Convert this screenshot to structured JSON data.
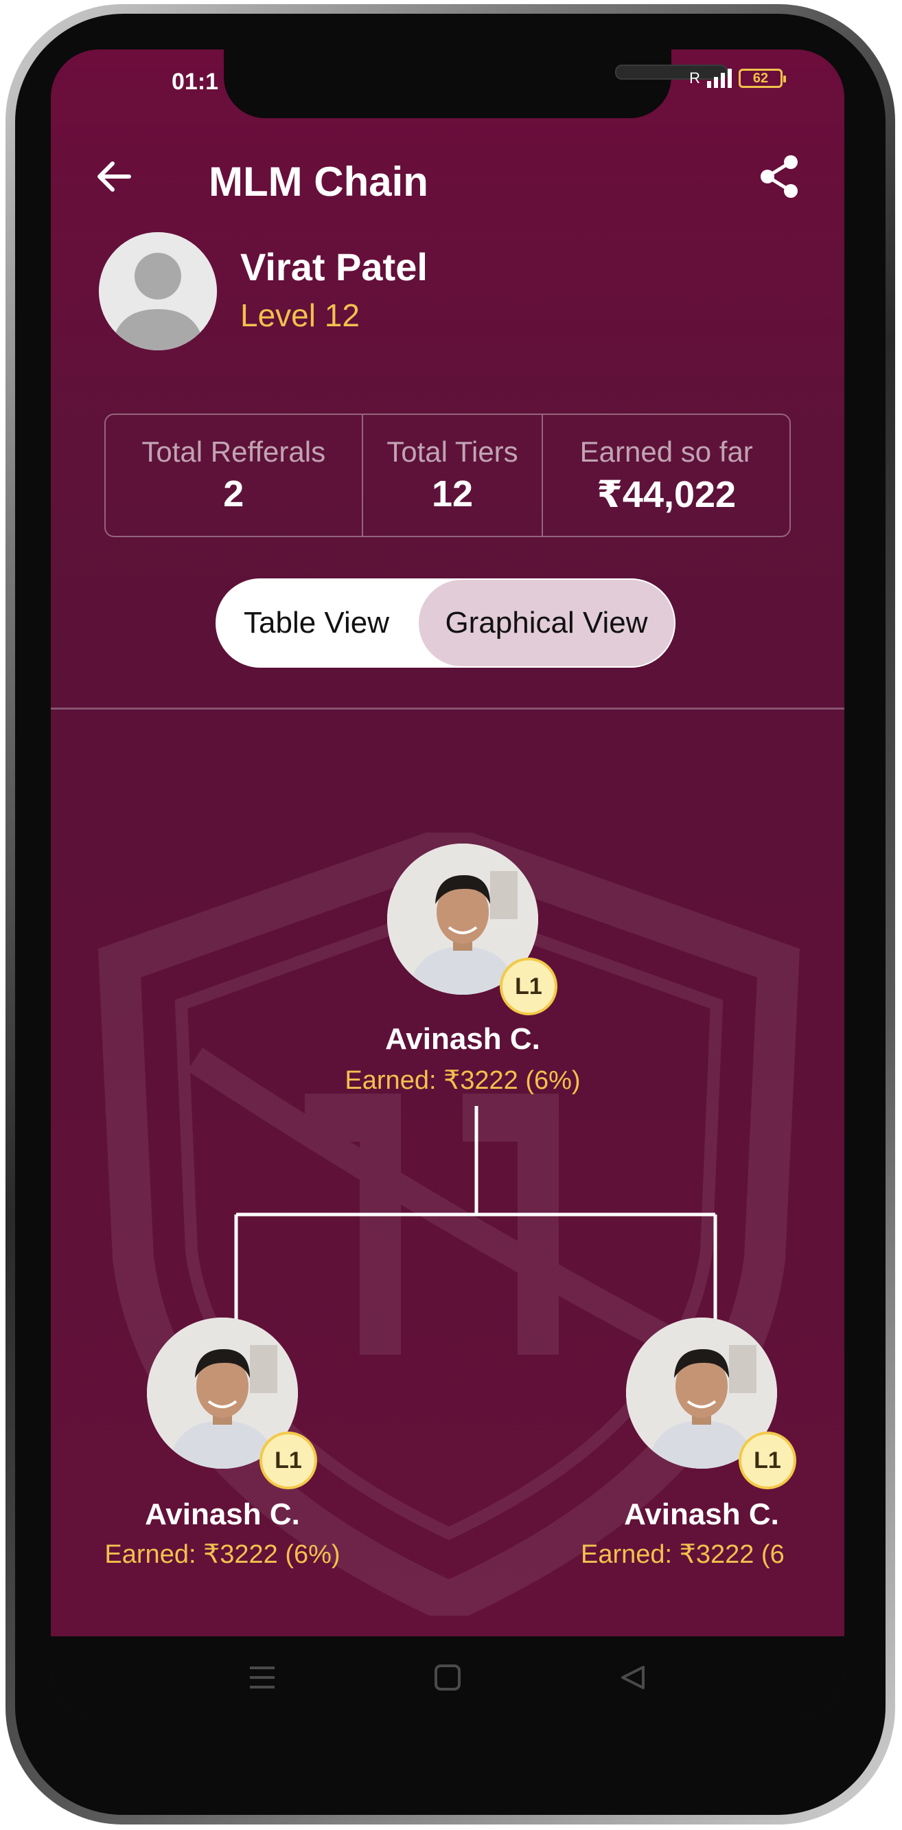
{
  "status_bar": {
    "time": "01:1",
    "network_label": "R",
    "battery": "62"
  },
  "header": {
    "title": "MLM Chain",
    "back_icon": "arrow-left-icon",
    "share_icon": "share-icon"
  },
  "profile": {
    "name": "Virat Patel",
    "level": "Level 12"
  },
  "stats": [
    {
      "label": "Total Refferals",
      "value": "2"
    },
    {
      "label": "Total Tiers",
      "value": "12"
    },
    {
      "label": "Earned so far",
      "value": "₹44,022"
    }
  ],
  "view_toggle": {
    "options": [
      "Table View",
      "Graphical View"
    ],
    "selected": "Graphical View"
  },
  "tree": {
    "root": {
      "name": "Avinash C.",
      "earned": "Earned: ₹3222 (6%)",
      "badge": "L1"
    },
    "children": [
      {
        "name": "Avinash C.",
        "earned": "Earned: ₹3222 (6%)",
        "badge": "L1"
      },
      {
        "name": "Avinash C.",
        "earned": "Earned: ₹3222 (6",
        "badge": "L1"
      }
    ]
  },
  "colors": {
    "background": "#5e1239",
    "accent": "#f2c14e",
    "badge": "#fbefb4"
  }
}
